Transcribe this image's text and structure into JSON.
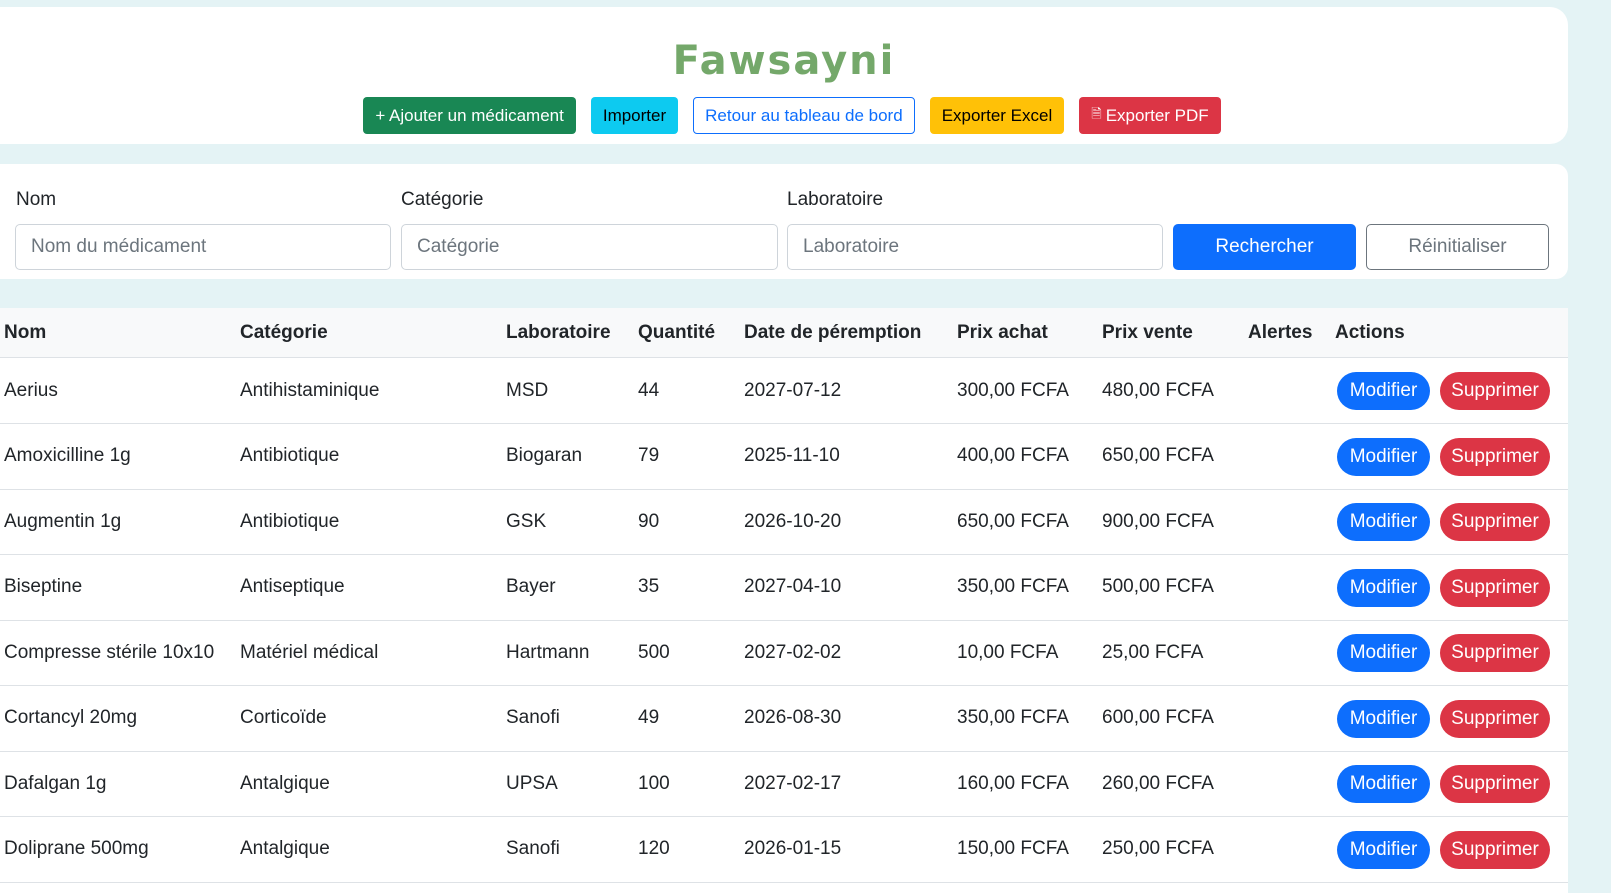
{
  "app": {
    "title": "Fawsayni"
  },
  "toolbar": {
    "add_label": "+ Ajouter un médicament",
    "import_label": "Importer",
    "back_label": "Retour au tableau de bord",
    "excel_label": "Exporter Excel",
    "pdf_icon": "🗎",
    "pdf_label": "Exporter PDF"
  },
  "filters": {
    "name_label": "Nom",
    "name_placeholder": "Nom du médicament",
    "category_label": "Catégorie",
    "category_placeholder": "Catégorie",
    "lab_label": "Laboratoire",
    "lab_placeholder": "Laboratoire",
    "search_label": "Rechercher",
    "reset_label": "Réinitialiser"
  },
  "table": {
    "headers": {
      "name": "Nom",
      "category": "Catégorie",
      "lab": "Laboratoire",
      "qty": "Quantité",
      "expiry": "Date de péremption",
      "buy": "Prix achat",
      "sell": "Prix vente",
      "alerts": "Alertes",
      "actions": "Actions"
    },
    "edit_label": "Modifier",
    "delete_label": "Supprimer",
    "rows": [
      {
        "name": "Aerius",
        "category": "Antihistaminique",
        "lab": "MSD",
        "qty": "44",
        "expiry": "2027-07-12",
        "buy": "300,00 FCFA",
        "sell": "480,00 FCFA",
        "alerts": ""
      },
      {
        "name": "Amoxicilline 1g",
        "category": "Antibiotique",
        "lab": "Biogaran",
        "qty": "79",
        "expiry": "2025-11-10",
        "buy": "400,00 FCFA",
        "sell": "650,00 FCFA",
        "alerts": ""
      },
      {
        "name": "Augmentin 1g",
        "category": "Antibiotique",
        "lab": "GSK",
        "qty": "90",
        "expiry": "2026-10-20",
        "buy": "650,00 FCFA",
        "sell": "900,00 FCFA",
        "alerts": ""
      },
      {
        "name": "Biseptine",
        "category": "Antiseptique",
        "lab": "Bayer",
        "qty": "35",
        "expiry": "2027-04-10",
        "buy": "350,00 FCFA",
        "sell": "500,00 FCFA",
        "alerts": ""
      },
      {
        "name": "Compresse stérile 10x10",
        "category": "Matériel médical",
        "lab": "Hartmann",
        "qty": "500",
        "expiry": "2027-02-02",
        "buy": "10,00 FCFA",
        "sell": "25,00 FCFA",
        "alerts": ""
      },
      {
        "name": "Cortancyl 20mg",
        "category": "Corticoïde",
        "lab": "Sanofi",
        "qty": "49",
        "expiry": "2026-08-30",
        "buy": "350,00 FCFA",
        "sell": "600,00 FCFA",
        "alerts": ""
      },
      {
        "name": "Dafalgan 1g",
        "category": "Antalgique",
        "lab": "UPSA",
        "qty": "100",
        "expiry": "2027-02-17",
        "buy": "160,00 FCFA",
        "sell": "260,00 FCFA",
        "alerts": ""
      },
      {
        "name": "Doliprane 500mg",
        "category": "Antalgique",
        "lab": "Sanofi",
        "qty": "120",
        "expiry": "2026-01-15",
        "buy": "150,00 FCFA",
        "sell": "250,00 FCFA",
        "alerts": ""
      }
    ]
  }
}
